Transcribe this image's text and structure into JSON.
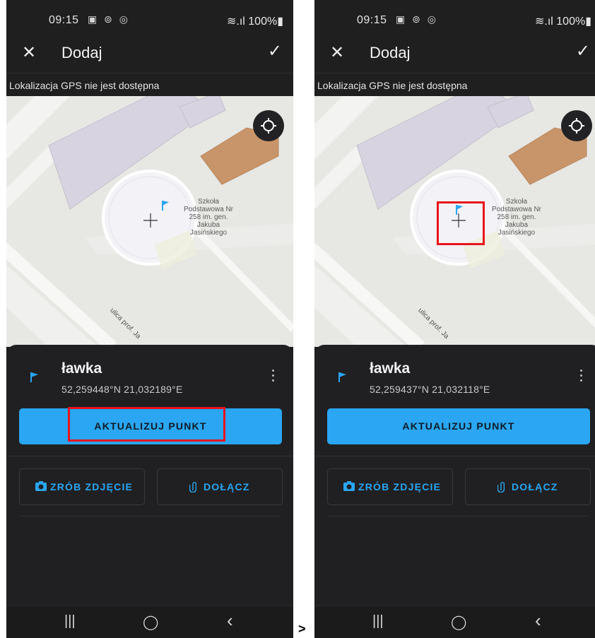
{
  "separator": ">",
  "colors": {
    "accent": "#2aa6f2",
    "highlight": "#e8141b",
    "building_orange": "#c8956a",
    "building_purple": "#d7d3e0"
  },
  "common": {
    "status_time": "09:15",
    "status_icons": "▣ ⊚ ◎",
    "status_right": "≋.ıl 100%▮",
    "close_icon": "close-icon",
    "title": "Dodaj",
    "confirm_icon": "check-icon",
    "gps_message": "Lokalizacja GPS nie jest dostępna",
    "map_poi_label": "Szkoła Podstawowa Nr 258 im. gen. Jakuba Jasińskiego",
    "street_label": "ulica prof. Ja",
    "update_label": "AKTUALIZUJ PUNKT",
    "photo_label": "ZRÓB ZDJĘCIE",
    "attach_label": "DOŁĄCZ",
    "nav_recent": "|||",
    "nav_home": "◯",
    "nav_back": "‹"
  },
  "screens": [
    {
      "point_name": "ławka",
      "coordinates": "52,259448°N 21,032189°E",
      "highlight_target": "update-button"
    },
    {
      "point_name": "ławka",
      "coordinates": "52,259437°N 21,032118°E",
      "highlight_target": "map-crosshair"
    }
  ]
}
